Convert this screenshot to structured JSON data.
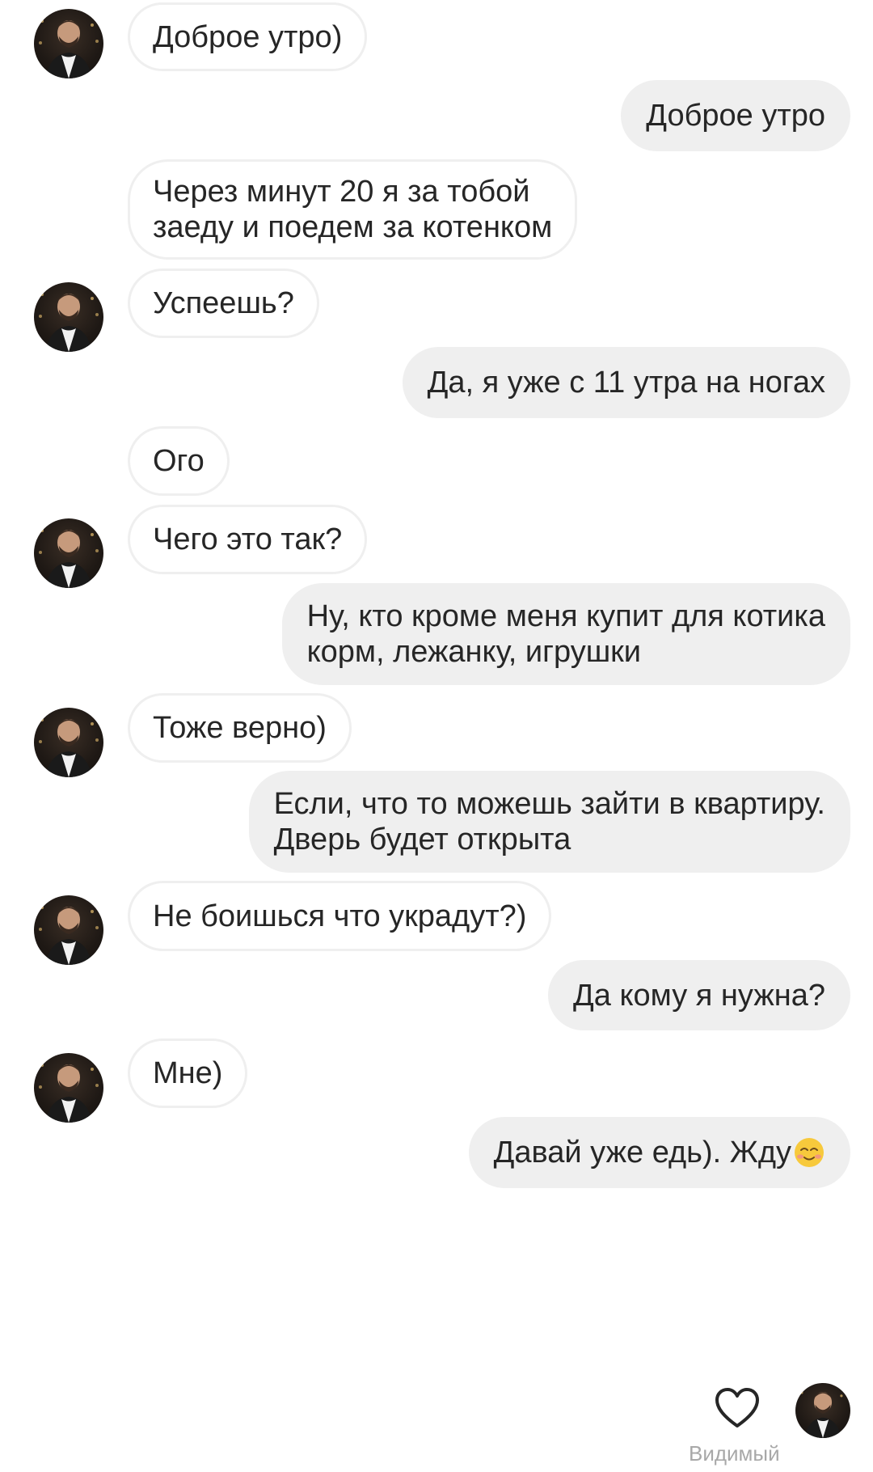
{
  "messages": [
    {
      "side": "in",
      "text": "Доброе утро)",
      "avatar": true
    },
    {
      "side": "out",
      "text": "Доброе утро"
    },
    {
      "side": "in",
      "text": "Через минут 20 я за тобой\nзаеду и поедем за котенком",
      "avatar": false
    },
    {
      "side": "in",
      "text": "Успеешь?",
      "avatar": true
    },
    {
      "side": "out",
      "text": "Да, я уже с 11 утра на ногах"
    },
    {
      "side": "in",
      "text": "Ого",
      "avatar": false
    },
    {
      "side": "in",
      "text": "Чего это так?",
      "avatar": true
    },
    {
      "side": "out",
      "text": "Ну, кто кроме меня купит для котика\nкорм, лежанку, игрушки"
    },
    {
      "side": "in",
      "text": "Тоже верно)",
      "avatar": true
    },
    {
      "side": "out",
      "text": "Если, что то можешь зайти в квартиру.\nДверь будет открыта"
    },
    {
      "side": "in",
      "text": "Не боишься что украдут?)",
      "avatar": true
    },
    {
      "side": "out",
      "text": "Да кому я нужна?"
    },
    {
      "side": "in",
      "text": "Мне)",
      "avatar": true
    },
    {
      "side": "out",
      "text": "Давай уже едь). Жду",
      "emoji": "smiling-face-emoji"
    }
  ],
  "footer": {
    "like_icon": "heart-outline-icon",
    "seen_label": "Видимый"
  },
  "colors": {
    "incoming_bubble_border": "#efefef",
    "outgoing_bubble": "#efefef",
    "text": "#262626",
    "seen_text": "#a8a8a8"
  }
}
